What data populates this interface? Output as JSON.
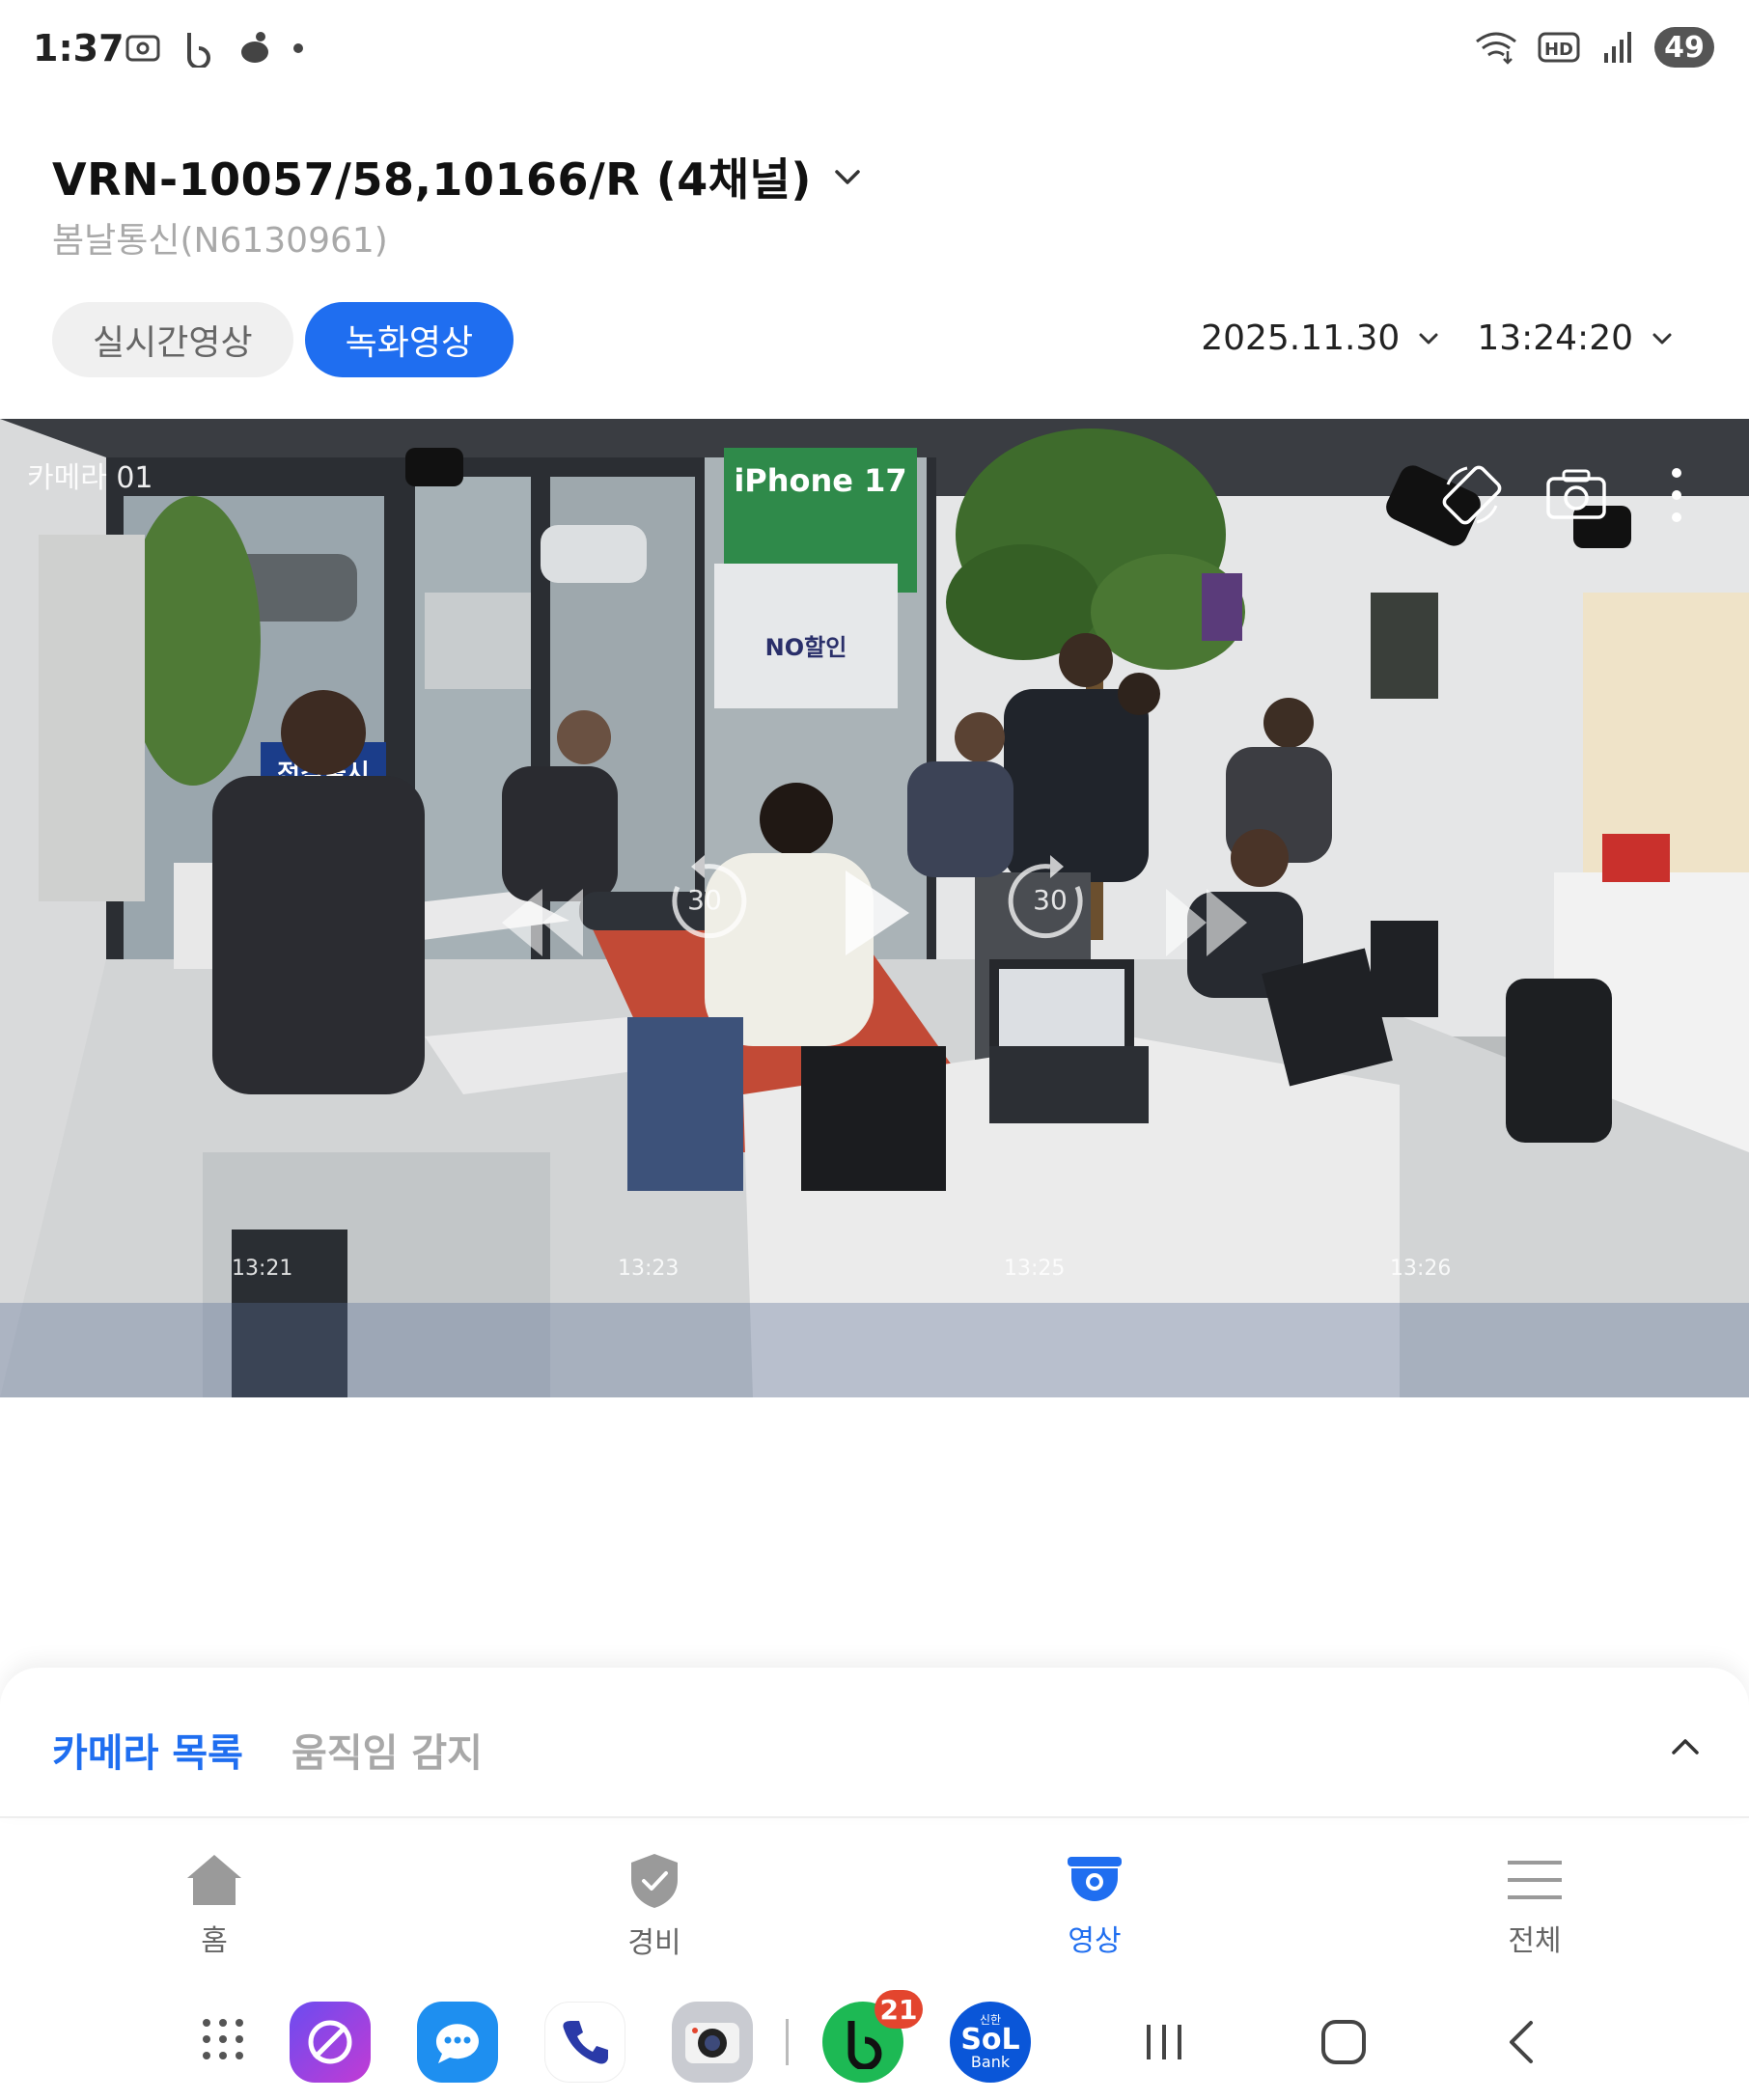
{
  "status_bar": {
    "time": "1:37",
    "left_icons": [
      "screenshot-icon",
      "b-app-icon",
      "bean-icon",
      "notification-dot-icon"
    ],
    "right_icons": [
      "wifi-icon",
      "hd-voice-icon",
      "signal-icon"
    ],
    "battery": "49"
  },
  "header": {
    "device_title": "VRN-10057/58,10166/R (4채널)",
    "device_subtitle": "봄날통신(N6130961)"
  },
  "mode_tabs": [
    {
      "label": "실시간영상",
      "active": false
    },
    {
      "label": "녹화영상",
      "active": true
    }
  ],
  "playback": {
    "date": "2025.11.30",
    "time": "13:24:20"
  },
  "video": {
    "camera_label": "카메라 01",
    "skip_back_seconds": "30",
    "skip_forward_seconds": "30",
    "timeline_ticks": [
      "13:21",
      "13:23",
      "13:25",
      "13:26"
    ],
    "scene_text": {
      "window_poster_1": "iPhone 17",
      "window_poster_2": "NO할인",
      "window_banner": "전격출시"
    }
  },
  "bottom_sheet": {
    "tabs": [
      {
        "label": "카메라 목록",
        "active": true
      },
      {
        "label": "움직임 감지",
        "active": false
      }
    ]
  },
  "bottom_nav": [
    {
      "label": "홈",
      "icon": "home-icon",
      "active": false
    },
    {
      "label": "경비",
      "icon": "shield-icon",
      "active": false
    },
    {
      "label": "영상",
      "icon": "cctv-camera-icon",
      "active": true
    },
    {
      "label": "전체",
      "icon": "menu-icon",
      "active": false
    }
  ],
  "dock": {
    "apps": [
      "app-drawer-icon",
      "internet-browser-icon",
      "messages-icon",
      "phone-icon",
      "camera-app-icon",
      "b-app-icon",
      "sol-bank-icon"
    ],
    "b_app_badge": "21",
    "sol_bank_label_top": "신한",
    "sol_bank_label_main": "SoL",
    "sol_bank_label_bottom": "Bank"
  },
  "colors": {
    "accent": "#1f6ef0",
    "inactive_tab_bg": "#f0f0f0",
    "subtitle_gray": "#a9a9a9",
    "badge_red": "#e3452e"
  }
}
